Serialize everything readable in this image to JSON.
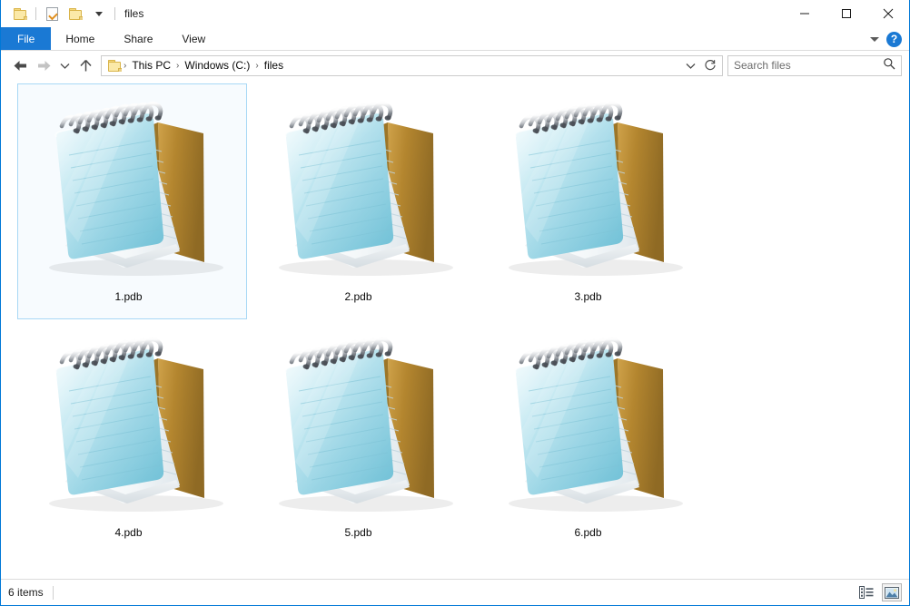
{
  "window": {
    "title": "files",
    "quick_access": [
      {
        "name": "folder-icon",
        "label": "Folder"
      },
      {
        "name": "properties-icon",
        "label": "Properties"
      },
      {
        "name": "new-folder-icon",
        "label": "New folder"
      },
      {
        "name": "customize-chevron-icon",
        "label": "Customize Quick Access Toolbar"
      }
    ],
    "controls": {
      "minimize": "Minimize",
      "maximize": "Maximize",
      "close": "Close"
    }
  },
  "ribbon": {
    "tabs": [
      {
        "label": "File",
        "active": true
      },
      {
        "label": "Home",
        "active": false
      },
      {
        "label": "Share",
        "active": false
      },
      {
        "label": "View",
        "active": false
      }
    ],
    "collapse_label": "Minimize the Ribbon",
    "help_label": "?"
  },
  "navigation": {
    "back": "Back",
    "forward": "Forward",
    "recent": "Recent locations",
    "up": "Up",
    "breadcrumb": [
      "This PC",
      "Windows (C:)",
      "files"
    ],
    "separator": "›",
    "dropdown": "Previous locations",
    "refresh": "Refresh"
  },
  "search": {
    "placeholder": "Search files",
    "value": "",
    "icon": "search-icon"
  },
  "files": [
    {
      "name": "1.pdb",
      "icon": "notepad-file-icon",
      "selected": true
    },
    {
      "name": "2.pdb",
      "icon": "notepad-file-icon",
      "selected": false
    },
    {
      "name": "3.pdb",
      "icon": "notepad-file-icon",
      "selected": false
    },
    {
      "name": "4.pdb",
      "icon": "notepad-file-icon",
      "selected": false
    },
    {
      "name": "5.pdb",
      "icon": "notepad-file-icon",
      "selected": false
    },
    {
      "name": "6.pdb",
      "icon": "notepad-file-icon",
      "selected": false
    }
  ],
  "status": {
    "item_count": "6 items",
    "views": [
      {
        "name": "details-view-button",
        "label": "Details view",
        "active": false
      },
      {
        "name": "large-icons-view-button",
        "label": "Large icons view",
        "active": true
      }
    ]
  },
  "colors": {
    "accent": "#1a79d4",
    "window_border": "#0078d7",
    "selection_border": "#a8d8f5",
    "icon_teal": "#8fd2e3",
    "icon_tan": "#b98d35"
  }
}
